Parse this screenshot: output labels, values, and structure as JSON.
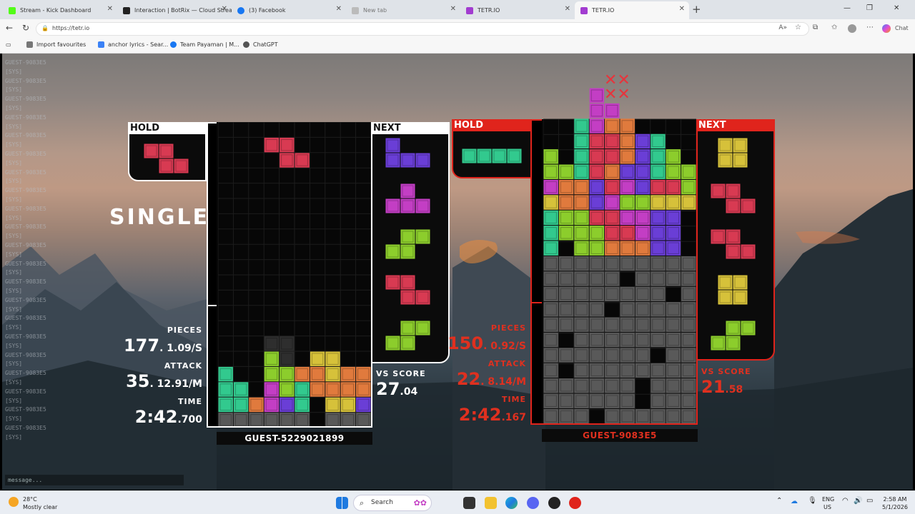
{
  "browser": {
    "tabs": [
      {
        "label": "Stream - Kick Dashboard",
        "color": "#53fc18"
      },
      {
        "label": "Interaction | BotRix — Cloud Stream",
        "color": "#222222"
      },
      {
        "label": "(3) Facebook",
        "color": "#1877f2"
      },
      {
        "label": "New tab",
        "color": "#bbbbbb"
      },
      {
        "label": "TETR.IO",
        "color": "#a23cd0"
      },
      {
        "label": "TETR.IO",
        "color": "#a23cd0"
      }
    ],
    "url": "https://tetr.io",
    "favorites": [
      {
        "label": "Import favourites",
        "color": "#777777"
      },
      {
        "label": "anchor lyrics - Sear...",
        "color": "#3b82f6"
      },
      {
        "label": "Team Payaman | M...",
        "color": "#1877f2"
      },
      {
        "label": "ChatGPT",
        "color": "#555555"
      }
    ]
  },
  "chat": {
    "lines": [
      "GUEST-9083E5",
      "[SYS]",
      "GUEST-9083E5",
      "[SYS]",
      "GUEST-9083E5",
      "[SYS]",
      "GUEST-9083E5",
      "[SYS]",
      "GUEST-9083E5",
      "[SYS]",
      "GUEST-9083E5",
      "[SYS]",
      "GUEST-9083E5",
      "[SYS]",
      "GUEST-9083E5",
      "[SYS]",
      "GUEST-9083E5",
      "[SYS]",
      "GUEST-9083E5",
      "[SYS]",
      "GUEST-9083E5",
      "[SYS]",
      "GUEST-9083E5",
      "[SYS]",
      "GUEST-9083E5",
      "[SYS]",
      "GUEST-9083E5",
      "[SYS]",
      "GUEST-9083E5",
      "[SYS]",
      "GUEST-9083E5",
      "[SYS]",
      "GUEST-9083E5",
      "[SYS]",
      "GUEST-9083E5",
      "[SYS]",
      "GUEST-9083E5",
      "[SYS]",
      "GUEST-9083E5",
      "[SYS]",
      "GUEST-9083E5",
      "[SYS]"
    ],
    "placeholder": "message..."
  },
  "left": {
    "hold_label": "HOLD",
    "next_label": "NEXT",
    "clear_text": "SINGLE",
    "pieces_label": "PIECES",
    "pieces_big": "177",
    "pieces_small": ". 1.09/S",
    "attack_label": "ATTACK",
    "attack_big": "35",
    "attack_small": ". 12.91/M",
    "time_label": "TIME",
    "time_big": "2:42",
    "time_small": ".700",
    "vs_label": "VS SCORE",
    "vs_big": "27",
    "vs_small": ".04",
    "name": "GUEST-5229021899"
  },
  "right": {
    "hold_label": "HOLD",
    "next_label": "NEXT",
    "pieces_label": "PIECES",
    "pieces_big": "150",
    "pieces_small": ". 0.92/S",
    "attack_label": "ATTACK",
    "attack_big": "22",
    "attack_small": ". 8.14/M",
    "time_label": "TIME",
    "time_big": "2:42",
    "time_small": ".167",
    "vs_label": "VS SCORE",
    "vs_big": "21",
    "vs_small": ".58",
    "name": "GUEST-9083E5"
  },
  "taskbar": {
    "weather_temp": "28°C",
    "weather_desc": "Mostly clear",
    "search_label": "Search",
    "lang_top": "ENG",
    "lang_bottom": "US",
    "time": "2:58 AM",
    "date": "5/1/2026"
  },
  "colors": {
    "Z": "#d83a52",
    "S": "#8ccd2c",
    "L": "#e07a3d",
    "J": "#6a3ed6",
    "T": "#c33ec4",
    "I": "#32c98e",
    "O": "#d6c13a",
    "G": "#595959",
    "K": "#2e2e2e"
  }
}
